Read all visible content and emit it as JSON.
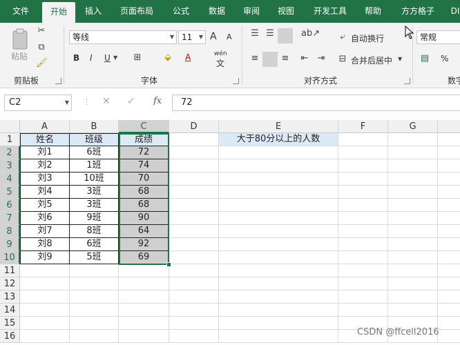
{
  "ribbon_tabs": [
    "文件",
    "开始",
    "插入",
    "页面布局",
    "公式",
    "数据",
    "审阅",
    "视图",
    "开发工具",
    "帮助",
    "方方格子",
    "DI"
  ],
  "ribbon": {
    "clipboard": {
      "paste": "粘贴",
      "label": "剪贴板"
    },
    "font": {
      "name": "等线",
      "size": "11",
      "bold": "B",
      "italic": "I",
      "underline": "U",
      "grow": "A",
      "shrink": "A",
      "color_a": "A",
      "phonetic": "wén",
      "phonetic_char": "文",
      "label": "字体"
    },
    "alignment": {
      "wrap": "自动换行",
      "merge": "合并后居中",
      "label": "对齐方式"
    },
    "number": {
      "format": "常规",
      "percent": "%",
      "label": "数字"
    }
  },
  "formula_bar": {
    "name_box": "C2",
    "fx": "fx",
    "value": "72"
  },
  "columns": [
    "A",
    "B",
    "C",
    "D",
    "E",
    "F",
    "G"
  ],
  "rows": [
    "1",
    "2",
    "3",
    "4",
    "5",
    "6",
    "7",
    "8",
    "9",
    "10",
    "11",
    "12",
    "13",
    "14",
    "15",
    "16"
  ],
  "table": {
    "headers": [
      "姓名",
      "班级",
      "成绩"
    ],
    "rows": [
      [
        "刘1",
        "6班",
        "72"
      ],
      [
        "刘2",
        "1班",
        "74"
      ],
      [
        "刘3",
        "10班",
        "70"
      ],
      [
        "刘4",
        "3班",
        "68"
      ],
      [
        "刘5",
        "3班",
        "68"
      ],
      [
        "刘6",
        "9班",
        "90"
      ],
      [
        "刘7",
        "8班",
        "64"
      ],
      [
        "刘8",
        "6班",
        "92"
      ],
      [
        "刘9",
        "5班",
        "69"
      ]
    ]
  },
  "e1_label": "大于80分以上的人数",
  "watermark": "CSDN @ffcell2016",
  "colors": {
    "accent": "#217346",
    "header_fill": "#dce9f6",
    "selection_fill": "#cfcfcf"
  }
}
